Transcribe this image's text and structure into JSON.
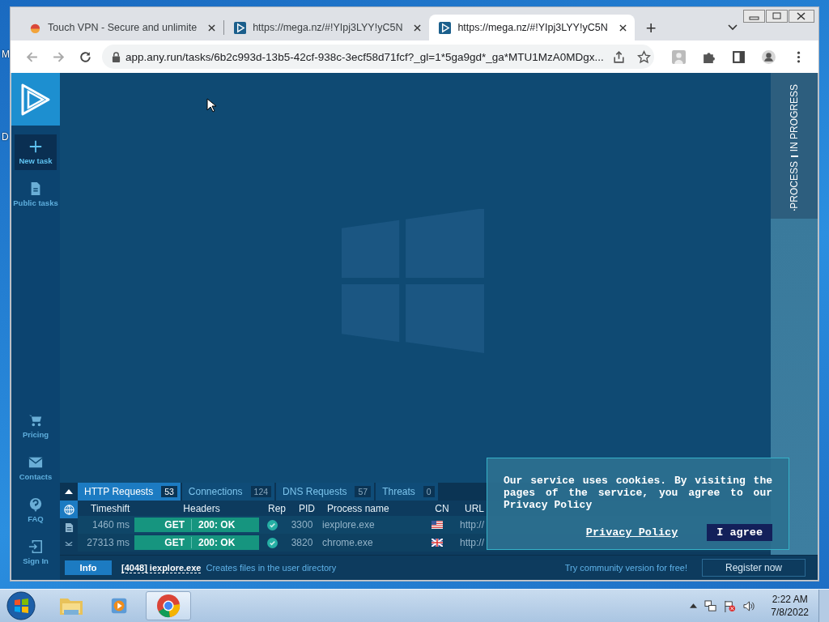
{
  "desktop": {
    "labels": [
      "M",
      "D"
    ]
  },
  "browser": {
    "tabs": [
      {
        "title": "Touch VPN - Secure and unlimite",
        "kind": "vpn",
        "selected": false
      },
      {
        "title": "https://mega.nz/#!YIpj3LYY!yC5N",
        "kind": "anyrun",
        "selected": false
      },
      {
        "title": "https://mega.nz/#!YIpj3LYY!yC5N",
        "kind": "anyrun",
        "selected": true
      }
    ],
    "new_tab": "+",
    "address": "app.any.run/tasks/6b2c993d-13b5-42cf-938c-3ecf58d71fcf?_gl=1*5ga9gd*_ga*MTU1MzA0MDgx..."
  },
  "sidebar": {
    "top_items": [
      {
        "label": "New task",
        "kind": "plus",
        "selected": true
      },
      {
        "label": "Public tasks",
        "kind": "document",
        "selected": false
      }
    ],
    "bottom_items": [
      {
        "label": "Pricing",
        "kind": "cart",
        "selected": false
      },
      {
        "label": "Contacts",
        "kind": "mail",
        "selected": false
      },
      {
        "label": "FAQ",
        "kind": "help",
        "selected": false
      },
      {
        "label": "Sign In",
        "kind": "signin",
        "selected": false
      }
    ]
  },
  "side_panel": {
    "label": "PROCESS",
    "status": "IN PROGRESS"
  },
  "panel": {
    "tabs": [
      {
        "label": "HTTP Requests",
        "count": "53",
        "selected": true
      },
      {
        "label": "Connections",
        "count": "124",
        "selected": false
      },
      {
        "label": "DNS Requests",
        "count": "57",
        "selected": false
      },
      {
        "label": "Threats",
        "count": "0",
        "selected": false
      }
    ],
    "side_icons": [
      {
        "kind": "globe",
        "selected": true
      },
      {
        "kind": "document",
        "selected": false
      },
      {
        "kind": "other",
        "selected": false
      }
    ],
    "columns": [
      "Timeshift",
      "Headers",
      "Rep",
      "PID",
      "Process name",
      "CN",
      "URL"
    ],
    "rows": [
      {
        "timeshift": "1460 ms",
        "method": "GET",
        "status": "200: OK",
        "pid": "3300",
        "process": "iexplore.exe",
        "kind": "us",
        "url": "http://"
      },
      {
        "timeshift": "27313 ms",
        "method": "GET",
        "status": "200: OK",
        "pid": "3820",
        "process": "chrome.exe",
        "kind": "gb",
        "url": "http://"
      }
    ]
  },
  "info_bar": {
    "button": "Info",
    "process": "[4048] iexplore.exe",
    "message": "Creates files in the user directory",
    "promo": "Try community version for free!",
    "register": "Register now"
  },
  "cookie": {
    "text": "Our service uses cookies. By visiting the pages of the service, you agree to our Privacy Policy",
    "link": "Privacy Policy",
    "button": "I agree"
  },
  "taskbar": {
    "apps": [
      {
        "kind": "explorer",
        "selected": false
      },
      {
        "kind": "media",
        "selected": false
      },
      {
        "kind": "chrome",
        "selected": true
      }
    ],
    "time": "2:22 AM",
    "date": "7/8/2022"
  }
}
